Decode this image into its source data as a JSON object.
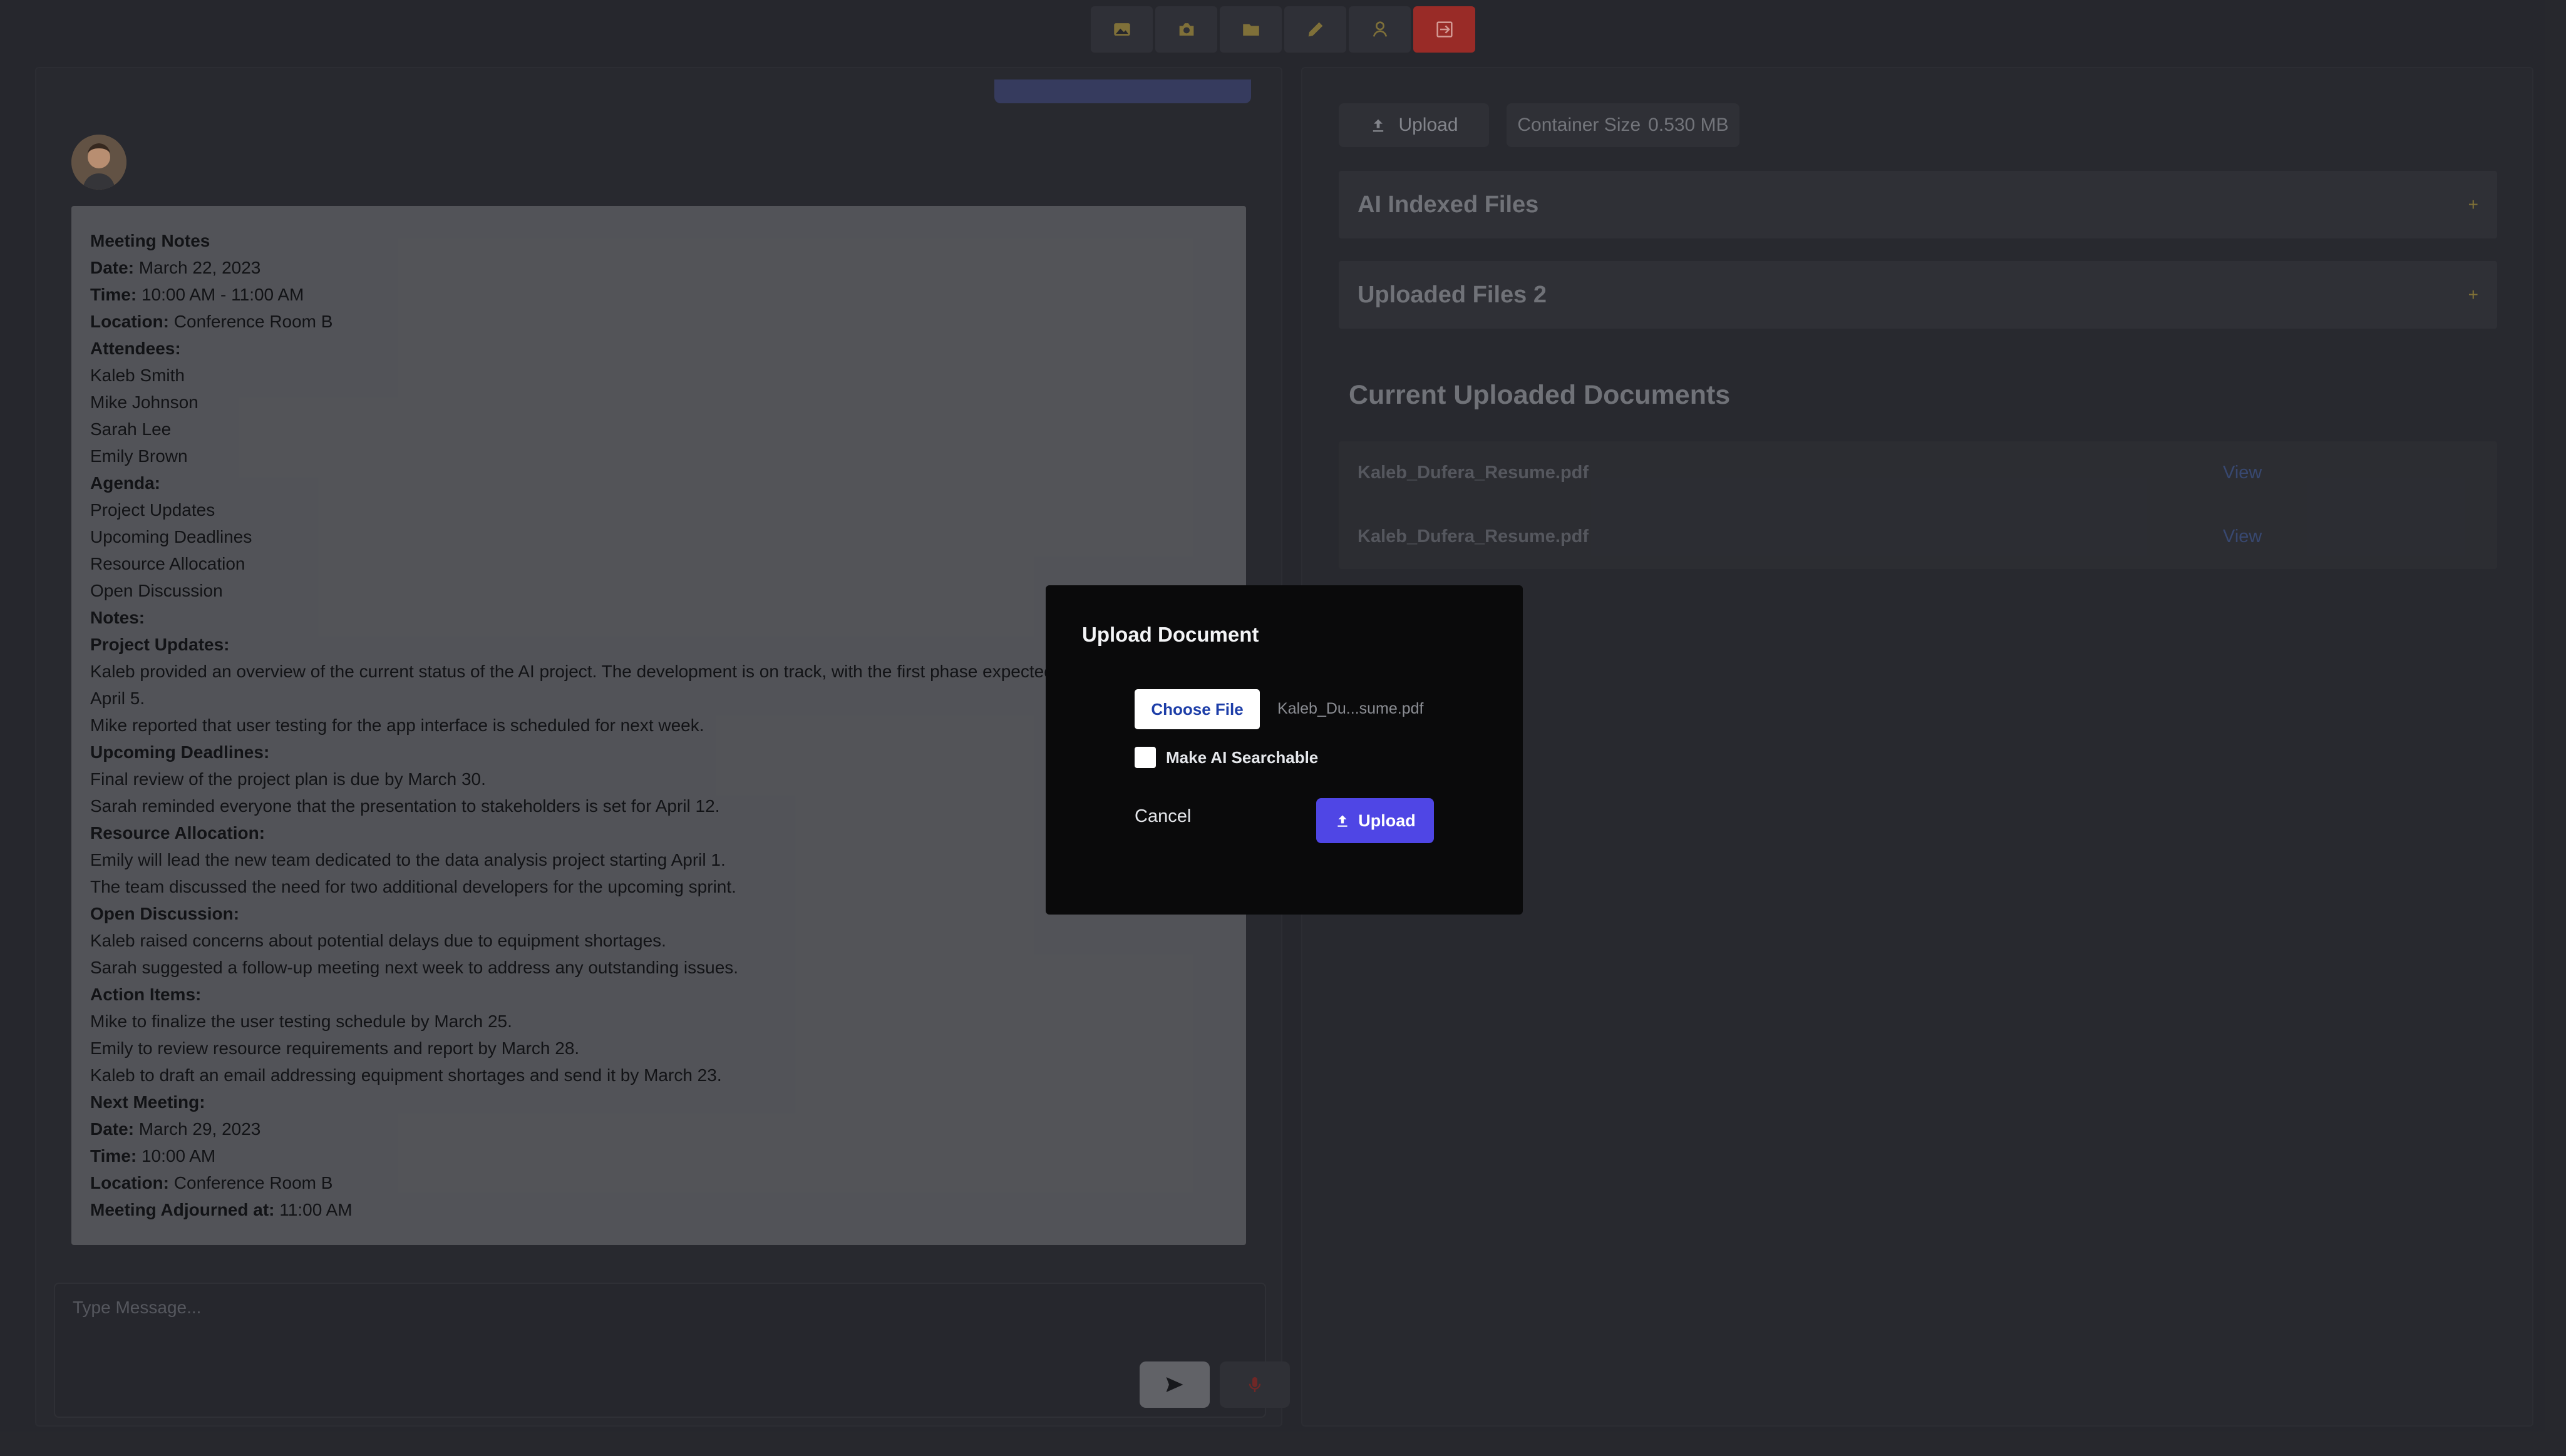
{
  "toolbar": {
    "icons": [
      "image-icon",
      "camera-icon",
      "folder-icon",
      "pencil-icon",
      "user-icon",
      "logout-icon"
    ]
  },
  "chat": {
    "message_lines": [
      {
        "bold": "Meeting Notes",
        "text": ""
      },
      {
        "bold": "Date:",
        "text": " March 22, 2023"
      },
      {
        "bold": "Time:",
        "text": " 10:00 AM - 11:00 AM"
      },
      {
        "bold": "Location:",
        "text": " Conference Room B"
      },
      {
        "bold": "Attendees:",
        "text": ""
      },
      {
        "bold": "",
        "text": "Kaleb Smith"
      },
      {
        "bold": "",
        "text": "Mike Johnson"
      },
      {
        "bold": "",
        "text": "Sarah Lee"
      },
      {
        "bold": "",
        "text": "Emily Brown"
      },
      {
        "bold": "Agenda:",
        "text": ""
      },
      {
        "bold": "",
        "text": "Project Updates"
      },
      {
        "bold": "",
        "text": "Upcoming Deadlines"
      },
      {
        "bold": "",
        "text": "Resource Allocation"
      },
      {
        "bold": "",
        "text": "Open Discussion"
      },
      {
        "bold": "Notes:",
        "text": ""
      },
      {
        "bold": "Project Updates:",
        "text": ""
      },
      {
        "bold": "",
        "text": "Kaleb provided an overview of the current status of the AI project. The development is on track, with the first phase expected"
      },
      {
        "bold": "",
        "text": "April 5."
      },
      {
        "bold": "",
        "text": "Mike reported that user testing for the app interface is scheduled for next week."
      },
      {
        "bold": "Upcoming Deadlines:",
        "text": ""
      },
      {
        "bold": "",
        "text": "Final review of the project plan is due by March 30."
      },
      {
        "bold": "",
        "text": "Sarah reminded everyone that the presentation to stakeholders is set for April 12."
      },
      {
        "bold": "Resource Allocation:",
        "text": ""
      },
      {
        "bold": "",
        "text": "Emily will lead the new team dedicated to the data analysis project starting April 1."
      },
      {
        "bold": "",
        "text": "The team discussed the need for two additional developers for the upcoming sprint."
      },
      {
        "bold": "Open Discussion:",
        "text": ""
      },
      {
        "bold": "",
        "text": "Kaleb raised concerns about potential delays due to equipment shortages."
      },
      {
        "bold": "",
        "text": "Sarah suggested a follow-up meeting next week to address any outstanding issues."
      },
      {
        "bold": "Action Items:",
        "text": ""
      },
      {
        "bold": "",
        "text": "Mike to finalize the user testing schedule by March 25."
      },
      {
        "bold": "",
        "text": "Emily to review resource requirements and report by March 28."
      },
      {
        "bold": "",
        "text": "Kaleb to draft an email addressing equipment shortages and send it by March 23."
      },
      {
        "bold": "Next Meeting:",
        "text": ""
      },
      {
        "bold": "Date:",
        "text": " March 29, 2023"
      },
      {
        "bold": "Time:",
        "text": " 10:00 AM"
      },
      {
        "bold": "Location:",
        "text": " Conference Room B"
      },
      {
        "bold": "Meeting Adjourned at:",
        "text": " 11:00 AM"
      }
    ],
    "composer": {
      "placeholder": "Type Message..."
    }
  },
  "files": {
    "upload_label": "Upload",
    "container_size_label": "Container Size",
    "container_size_value": "0.530 MB",
    "ai_indexed_label": "AI Indexed Files",
    "uploaded_files_label": "Uploaded Files 2",
    "expand_symbol": "+",
    "current_docs_title": "Current Uploaded Documents",
    "documents": [
      {
        "name": "Kaleb_Dufera_Resume.pdf",
        "action": "View"
      },
      {
        "name": "Kaleb_Dufera_Resume.pdf",
        "action": "View"
      }
    ]
  },
  "modal": {
    "title": "Upload Document",
    "choose_file_label": "Choose File",
    "selected_file": "Kaleb_Du...sume.pdf",
    "ai_searchable_label": "Make AI Searchable",
    "ai_searchable_checked": false,
    "cancel_label": "Cancel",
    "upload_label": "Upload",
    "accent_color": "#4f46e5"
  }
}
